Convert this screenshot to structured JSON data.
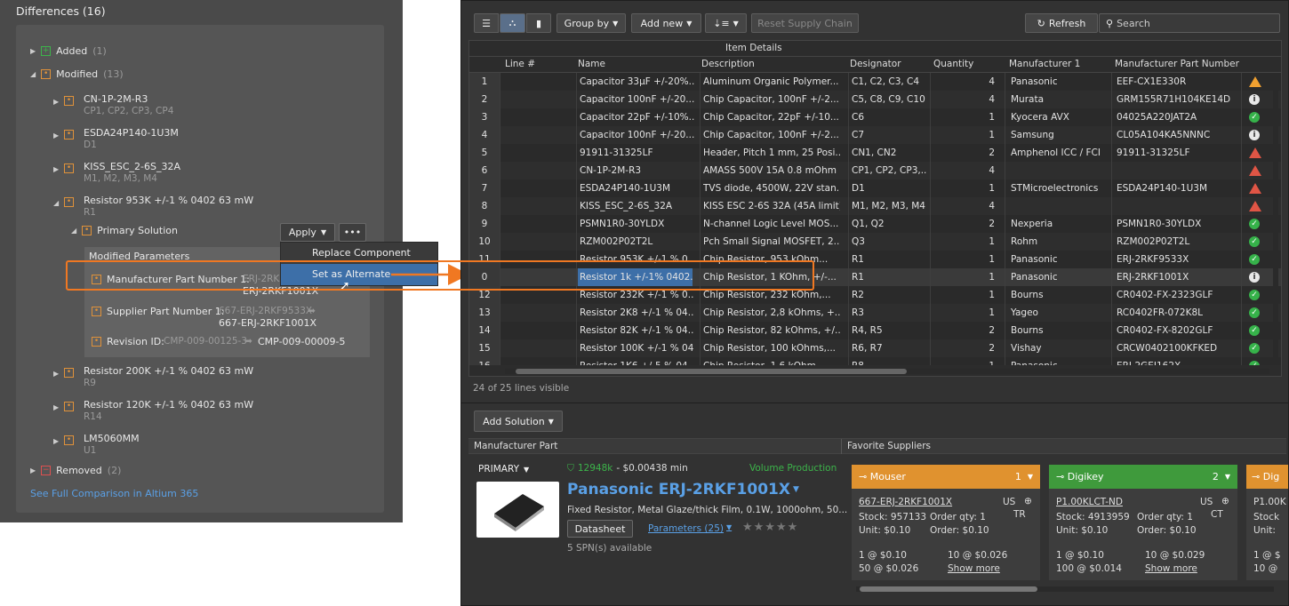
{
  "left": {
    "title": "Differences  (16)",
    "added_label": "Added",
    "added_count": "(1)",
    "modified_label": "Modified",
    "modified_count": "(13)",
    "items": [
      {
        "name": "CN-1P-2M-R3",
        "des": "CP1, CP2, CP3, CP4"
      },
      {
        "name": "ESDA24P140-1U3M",
        "des": "D1"
      },
      {
        "name": "KISS_ESC_2-6S_32A",
        "des": "M1, M2, M3, M4"
      },
      {
        "name": "Resistor 953K +/-1 % 0402 63 mW",
        "des": "R1"
      }
    ],
    "primary": "Primary Solution",
    "apply": "Apply",
    "more": "•••",
    "menu": [
      "Replace Component",
      "Set as Alternate"
    ],
    "params_title": "Modified Parameters",
    "p1_label": "Manufacturer Part Number 1:",
    "p1_old": "ERJ-2RK",
    "p1_new": "ERJ-2RKF1001X",
    "p2_label": "Supplier Part Number 1:",
    "p2_old": "667-ERJ-2RKF9533X",
    "p2_new": "667-ERJ-2RKF1001X",
    "p3_label": "Revision ID:",
    "p3_old": "CMP-009-00125-3",
    "p3_new": "CMP-009-00009-5",
    "items2": [
      {
        "name": "Resistor 200K +/-1 % 0402 63 mW",
        "des": "R9"
      },
      {
        "name": "Resistor 120K +/-1 % 0402 63 mW",
        "des": "R14"
      },
      {
        "name": "LM5060MM",
        "des": "U1"
      }
    ],
    "removed_label": "Removed",
    "removed_count": "(2)",
    "link": "See Full Comparison in Altium 365"
  },
  "toolbar": {
    "group_by": "Group by",
    "add_new": "Add new",
    "reset": "Reset Supply Chain",
    "refresh": "Refresh",
    "search_placeholder": "Search"
  },
  "grid": {
    "group_header": "Item Details",
    "columns": [
      "Line #",
      "Name",
      "Description",
      "Designator",
      "Quantity",
      "Manufacturer 1",
      "Manufacturer Part Number"
    ],
    "rows": [
      {
        "n": "1",
        "name": "Capacitor 33µF +/-20%...",
        "desc": "Aluminum Organic Polymer...",
        "des": "C1, C2, C3, C4",
        "qty": "4",
        "mfr": "Panasonic",
        "mpn": "EEF-CX1E330R",
        "st": "warno"
      },
      {
        "n": "2",
        "name": "Capacitor 100nF +/-20...",
        "desc": "Chip Capacitor, 100nF +/-2...",
        "des": "C5, C8, C9, C10",
        "qty": "4",
        "mfr": "Murata",
        "mpn": "GRM155R71H104KE14D",
        "st": "info"
      },
      {
        "n": "3",
        "name": "Capacitor 22pF +/-10%...",
        "desc": "Chip Capacitor, 22pF +/-10...",
        "des": "C6",
        "qty": "1",
        "mfr": "Kyocera AVX",
        "mpn": "04025A220JAT2A",
        "st": "ok"
      },
      {
        "n": "4",
        "name": "Capacitor 100nF +/-20...",
        "desc": "Chip Capacitor, 100nF +/-2...",
        "des": "C7",
        "qty": "1",
        "mfr": "Samsung",
        "mpn": "CL05A104KA5NNNC",
        "st": "info"
      },
      {
        "n": "5",
        "name": "91911-31325LF",
        "desc": "Header, Pitch 1 mm, 25 Posi...",
        "des": "CN1, CN2",
        "qty": "2",
        "mfr": "Amphenol ICC / FCI",
        "mpn": "91911-31325LF",
        "st": "warn"
      },
      {
        "n": "6",
        "name": "CN-1P-2M-R3",
        "desc": "AMASS 500V 15A  0.8 mOhm",
        "des": "CP1, CP2, CP3,...",
        "qty": "4",
        "mfr": "",
        "mpn": "",
        "st": "warn"
      },
      {
        "n": "7",
        "name": "ESDA24P140-1U3M",
        "desc": "TVS diode, 4500W, 22V stan...",
        "des": "D1",
        "qty": "1",
        "mfr": "STMicroelectronics",
        "mpn": "ESDA24P140-1U3M",
        "st": "warn"
      },
      {
        "n": "8",
        "name": "KISS_ESC_2-6S_32A",
        "desc": "KISS ESC 2-6S 32A (45A limit)...",
        "des": "M1, M2, M3, M4",
        "qty": "4",
        "mfr": "",
        "mpn": "",
        "st": "warn"
      },
      {
        "n": "9",
        "name": "PSMN1R0-30YLDX",
        "desc": "N-channel Logic Level MOS...",
        "des": "Q1, Q2",
        "qty": "2",
        "mfr": "Nexperia",
        "mpn": "PSMN1R0-30YLDX",
        "st": "ok"
      },
      {
        "n": "10",
        "name": "RZM002P02T2L",
        "desc": "Pch Small Signal MOSFET, 2...",
        "des": "Q3",
        "qty": "1",
        "mfr": "Rohm",
        "mpn": "RZM002P02T2L",
        "st": "ok"
      },
      {
        "n": "11",
        "name": "Resistor 953K +/-1 % 0...",
        "desc": "Chip Resistor, 953 kOhm...",
        "des": "R1",
        "qty": "1",
        "mfr": "Panasonic",
        "mpn": "ERJ-2RKF9533X",
        "st": "ok"
      },
      {
        "n": "0",
        "name": "Resistor 1k +/-1% 0402...",
        "desc": "Chip Resistor, 1 KOhm, +/-...",
        "des": "R1",
        "qty": "1",
        "mfr": "Panasonic",
        "mpn": "ERJ-2RKF1001X",
        "st": "info"
      },
      {
        "n": "12",
        "name": "Resistor 232K +/-1 % 0...",
        "desc": "Chip Resistor, 232 kOhm,...",
        "des": "R2",
        "qty": "1",
        "mfr": "Bourns",
        "mpn": "CR0402-FX-2323GLF",
        "st": "ok"
      },
      {
        "n": "13",
        "name": "Resistor 2K8  +/-1 % 04...",
        "desc": "Chip Resistor, 2,8 kOhms, +...",
        "des": "R3",
        "qty": "1",
        "mfr": "Yageo",
        "mpn": "RC0402FR-072K8L",
        "st": "ok"
      },
      {
        "n": "14",
        "name": "Resistor 82K  +/-1 % 04...",
        "desc": "Chip Resistor, 82 kOhms, +/...",
        "des": "R4, R5",
        "qty": "2",
        "mfr": "Bourns",
        "mpn": "CR0402-FX-8202GLF",
        "st": "ok"
      },
      {
        "n": "15",
        "name": "Resistor 100K +/-1 % 04...",
        "desc": "Chip Resistor, 100 kOhms,...",
        "des": "R6, R7",
        "qty": "2",
        "mfr": "Vishay",
        "mpn": "CRCW0402100KFKED",
        "st": "ok"
      },
      {
        "n": "16",
        "name": "Resistor 1K6 +/-5 % 04...",
        "desc": "Chip Resistor, 1.6 kOhm...",
        "des": "R8",
        "qty": "1",
        "mfr": "Panasonic",
        "mpn": "ERJ-2GEJ162X",
        "st": "ok"
      }
    ],
    "footer": "24 of 25 lines visible"
  },
  "solution": {
    "add_solution": "Add Solution",
    "mpart_header": "Manufacturer Part",
    "fav_header": "Favorite Suppliers",
    "primary": "PRIMARY",
    "stock": "12948k",
    "price": "- $0.00438 min",
    "status": "Volume Production",
    "title": "Panasonic ERJ-2RKF1001X",
    "desc": "Fixed Resistor, Metal Glaze/thick Film, 0.1W, 1000ohm, 50...",
    "datasheet": "Datasheet",
    "parameters": "Parameters (25)",
    "spn": "5 SPN(s) available"
  },
  "suppliers": [
    {
      "name": "Mouser",
      "num": "1",
      "color": "#e0922f",
      "pn": "667-ERJ-2RKF1001X",
      "cc": "US",
      "reg": "TR",
      "stock": "Stock: 957133",
      "unit": "Unit: $0.10",
      "oq": "Order qty: 1",
      "oqp": "Order: $0.10",
      "p1": "1 @ $0.10",
      "p2": "10 @ $0.026",
      "p3": "50 @ $0.026",
      "more": "Show more"
    },
    {
      "name": "Digikey",
      "num": "2",
      "color": "#3f9a3c",
      "pn": "P1.00KLCT-ND",
      "cc": "US",
      "reg": "CT",
      "stock": "Stock: 4913959",
      "unit": "Unit: $0.10",
      "oq": "Order qty: 1",
      "oqp": "Order: $0.10",
      "p1": "1 @ $0.10",
      "p2": "10 @ $0.029",
      "p3": "100 @ $0.014",
      "more": "Show more"
    },
    {
      "name": "Dig",
      "pn": "P1.00K",
      "stock": "Stock",
      "unit": "Unit:",
      "p1": "1 @ $",
      "p3": "10 @"
    }
  ]
}
